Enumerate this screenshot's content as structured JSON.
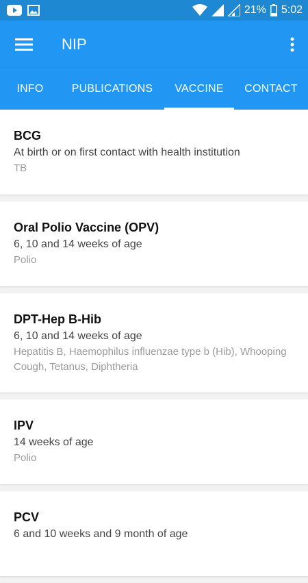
{
  "status_bar": {
    "battery": "21%",
    "time": "5:02"
  },
  "app_bar": {
    "title": "NIP"
  },
  "tabs": [
    {
      "label": "INFO"
    },
    {
      "label": "PUBLICATIONS"
    },
    {
      "label": "VACCINE",
      "active": true
    },
    {
      "label": "CONTACT"
    }
  ],
  "vaccines": [
    {
      "name": "BCG",
      "schedule": "At birth or on first contact with health institution",
      "diseases": "TB"
    },
    {
      "name": "Oral Polio Vaccine (OPV)",
      "schedule": "6, 10 and 14 weeks of age",
      "diseases": "Polio"
    },
    {
      "name": "DPT-Hep B-Hib",
      "schedule": "6, 10 and 14 weeks of age",
      "diseases": "Hepatitis B, Haemophilus influenzae type b (Hib), Whooping Cough, Tetanus, Diphtheria"
    },
    {
      "name": "IPV",
      "schedule": "14 weeks of age",
      "diseases": "Polio"
    },
    {
      "name": "PCV",
      "schedule": "6 and 10 weeks and 9 month of age",
      "diseases": ""
    }
  ],
  "colors": {
    "primary": "#2196f3",
    "status_bar": "#1e88d3"
  },
  "icons": [
    "youtube-icon",
    "gallery-icon",
    "wifi-icon",
    "signal-icon",
    "battery-icon",
    "menu-icon",
    "more-vert-icon"
  ]
}
